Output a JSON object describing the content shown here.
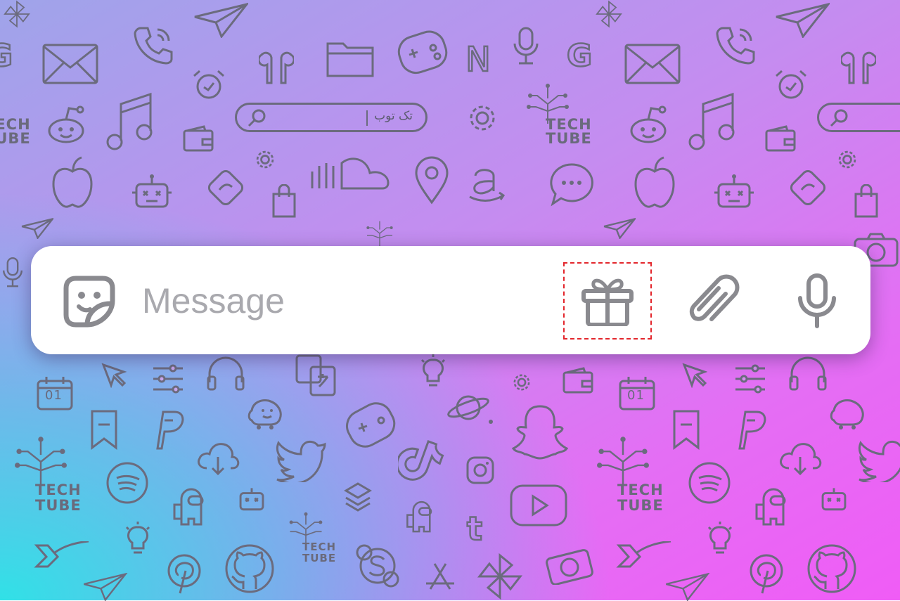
{
  "message_bar": {
    "placeholder": "Message",
    "icons": {
      "sticker": "sticker-icon",
      "gift": "gift-icon",
      "attach": "paperclip-icon",
      "voice": "microphone-icon"
    }
  },
  "annotation": {
    "arrow_color": "#e3262c",
    "highlight_color": "#e3262c",
    "arrow": "red-arrow-icon",
    "highlight": "dashed-highlight-box"
  },
  "background": {
    "search_text": "تک توب",
    "brand_line1": "TECH",
    "brand_line2": "TUBE",
    "netflix_letter": "N",
    "google_letter": "G",
    "tumblr_letter": "t",
    "calendar_day": "01"
  },
  "colors": {
    "bar_bg": "#ffffff",
    "icon_gray": "#8a8a8f",
    "pattern": "#6b6b7e"
  }
}
